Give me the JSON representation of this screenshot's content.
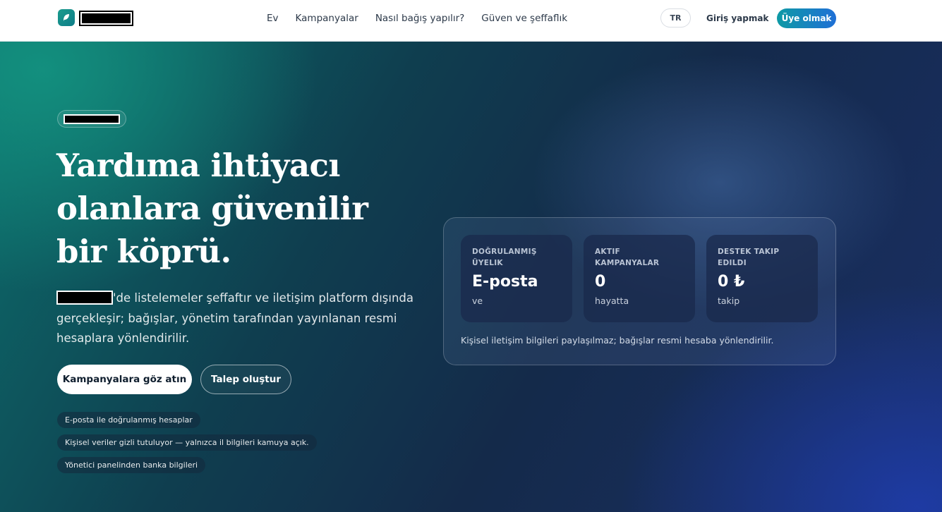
{
  "nav": {
    "links": [
      "Ev",
      "Kampanyalar",
      "Nasıl bağış yapılır?",
      "Güven ve şeffaflık"
    ],
    "language": "TR",
    "login": "Giriş yapmak",
    "signup": "Üye olmak"
  },
  "hero": {
    "title": "Yardıma ihtiyacı olanlara güvenilir bir köprü.",
    "description": "'de listelemeler şeffaftır ve iletişim platform dışında gerçekleşir; bağışlar, yönetim tarafından yayınlanan resmi hesaplara yönlendirilir.",
    "primary_button": "Kampanyalara göz atın",
    "secondary_button": "Talep oluştur",
    "chips": [
      "E-posta ile doğrulanmış hesaplar",
      "Kişisel veriler gizli tutuluyor — yalnızca il bilgileri kamuya açık.",
      "Yönetici panelinden banka bilgileri"
    ]
  },
  "stats": {
    "items": [
      {
        "label": "Doğrulanmış üyelik",
        "value": "E-posta",
        "sub": "ve"
      },
      {
        "label": "Aktif kampanyalar",
        "value": "0",
        "sub": "hayatta"
      },
      {
        "label": "Destek takip edildi",
        "value": "0 ₺",
        "sub": "takip"
      }
    ],
    "note": "Kişisel iletişim bilgileri paylaşılmaz; bağışlar resmi hesaba yönlendirilir."
  },
  "colors": {
    "brand_teal": "#0e9aa5",
    "brand_blue": "#1f6fd6",
    "nav_text": "#2d3a4a"
  },
  "icons": {
    "logo": "leaf-icon"
  }
}
